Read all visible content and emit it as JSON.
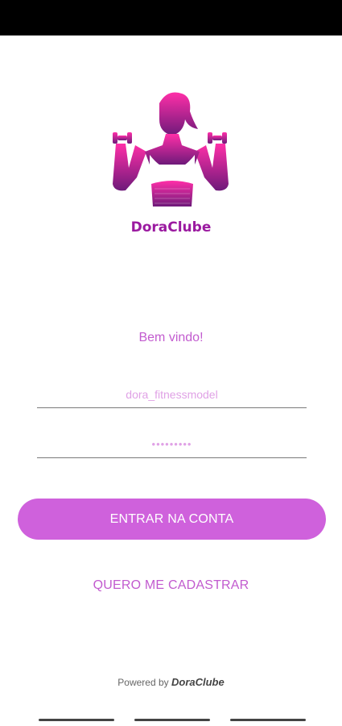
{
  "app": {
    "brand": "DoraClube",
    "logo_icon": "woman-dumbbells-logo-icon"
  },
  "login": {
    "welcome": "Bem vindo!",
    "username_value": "dora_fitnessmodel",
    "password_value": "•••••••••",
    "login_button": "ENTRAR NA CONTA",
    "register_link": "QUERO ME CADASTRAR"
  },
  "footer": {
    "powered_prefix": "Powered by",
    "powered_brand": "DoraClube"
  },
  "colors": {
    "accent": "#cf61dc",
    "brand": "#9b1aa0",
    "text_accent": "#c25bcf"
  }
}
